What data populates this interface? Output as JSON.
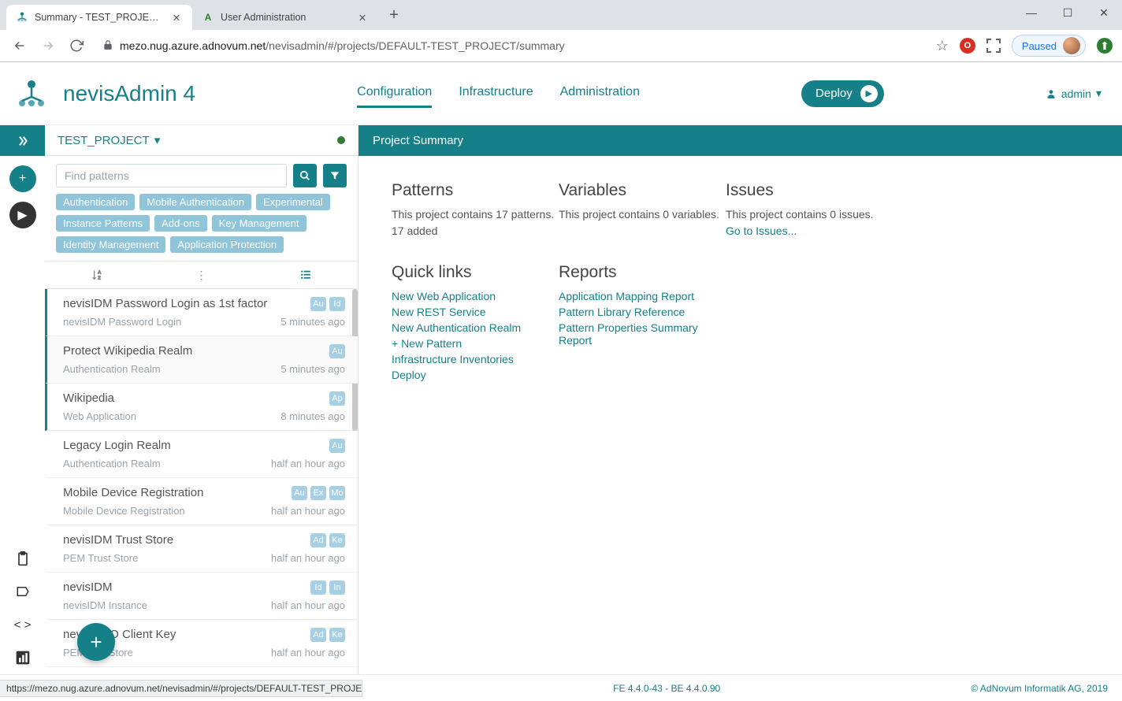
{
  "browser": {
    "tabs": [
      {
        "title": "Summary - TEST_PROJECT - nevi…",
        "active": true
      },
      {
        "title": "User Administration",
        "active": false
      }
    ],
    "url_host": "mezo.nug.azure.adnovum.net",
    "url_path": "/nevisadmin/#/projects/DEFAULT-TEST_PROJECT/summary",
    "paused_label": "Paused"
  },
  "app": {
    "title": "nevisAdmin 4",
    "nav": {
      "configuration": "Configuration",
      "infrastructure": "Infrastructure",
      "administration": "Administration"
    },
    "deploy": "Deploy",
    "user": "admin"
  },
  "sidebar": {
    "project": "TEST_PROJECT",
    "search_placeholder": "Find patterns",
    "tags": [
      "Authentication",
      "Mobile Authentication",
      "Experimental",
      "Instance Patterns",
      "Add-ons",
      "Key Management",
      "Identity Management",
      "Application Protection"
    ],
    "patterns": [
      {
        "title": "nevisIDM Password Login as 1st factor",
        "sub": "nevisIDM Password Login",
        "time": "5 minutes ago",
        "badges": [
          "Au",
          "Id"
        ]
      },
      {
        "title": "Protect Wikipedia Realm",
        "sub": "Authentication Realm",
        "time": "5 minutes ago",
        "badges": [
          "Au"
        ]
      },
      {
        "title": "Wikipedia",
        "sub": "Web Application",
        "time": "8 minutes ago",
        "badges": [
          "Ap"
        ]
      },
      {
        "title": "Legacy Login Realm",
        "sub": "Authentication Realm",
        "time": "half an hour ago",
        "badges": [
          "Au"
        ]
      },
      {
        "title": "Mobile Device Registration",
        "sub": "Mobile Device Registration",
        "time": "half an hour ago",
        "badges": [
          "Au",
          "Ex",
          "Mo"
        ]
      },
      {
        "title": "nevisIDM Trust Store",
        "sub": "PEM Trust Store",
        "time": "half an hour ago",
        "badges": [
          "Ad",
          "Ke"
        ]
      },
      {
        "title": "nevisIDM",
        "sub": "nevisIDM Instance",
        "time": "half an hour ago",
        "badges": [
          "Id",
          "In"
        ]
      },
      {
        "title": "nevisFIDO Client Key",
        "sub": "PEM Key Store",
        "time": "half an hour ago",
        "badges": [
          "Ad",
          "Ke"
        ]
      }
    ]
  },
  "main": {
    "header": "Project Summary",
    "patterns": {
      "title": "Patterns",
      "l1": "This project contains 17 patterns.",
      "l2": "17 added"
    },
    "variables": {
      "title": "Variables",
      "l1": "This project contains 0 variables."
    },
    "issues": {
      "title": "Issues",
      "l1": "This project contains 0 issues.",
      "link": "Go to Issues..."
    },
    "quicklinks": {
      "title": "Quick links",
      "items": [
        "New Web Application",
        "New REST Service",
        "New Authentication Realm",
        "+ New Pattern",
        "Infrastructure Inventories",
        "Deploy"
      ]
    },
    "reports": {
      "title": "Reports",
      "items": [
        "Application Mapping Report",
        "Pattern Library Reference",
        "Pattern Properties Summary Report"
      ]
    }
  },
  "status": {
    "hover_url": "https://mezo.nug.azure.adnovum.net/nevisadmin/#/projects/DEFAULT-TEST_PROJECT…",
    "version": "FE 4.4.0-43 - BE 4.4.0.90",
    "copyright": "© AdNovum Informatik AG, 2019"
  }
}
